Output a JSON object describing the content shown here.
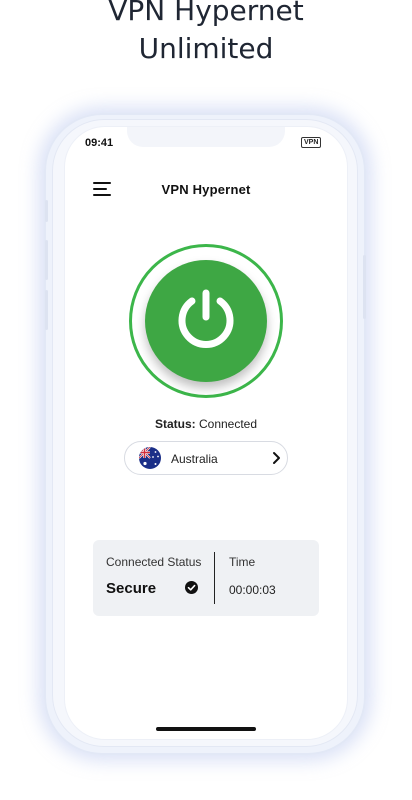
{
  "headline": {
    "line1": "VPN Hypernet",
    "line2": "Unlimited"
  },
  "status_bar": {
    "time": "09:41",
    "vpn_badge": "VPN"
  },
  "header": {
    "title": "VPN Hypernet",
    "menu_icon": "hamburger-menu-icon"
  },
  "power": {
    "icon": "power-icon",
    "color": "#3ea744",
    "ring_color": "#3cb64a"
  },
  "status": {
    "label": "Status:",
    "value": "Connected"
  },
  "location": {
    "country": "Australia",
    "flag_icon": "australia-flag-icon",
    "arrow_icon": "chevron-right-icon"
  },
  "info_card": {
    "connected_status_label": "Connected Status",
    "connected_status_value": "Secure",
    "check_icon": "check-circle-icon",
    "time_label": "Time",
    "time_value": "00:00:03"
  }
}
